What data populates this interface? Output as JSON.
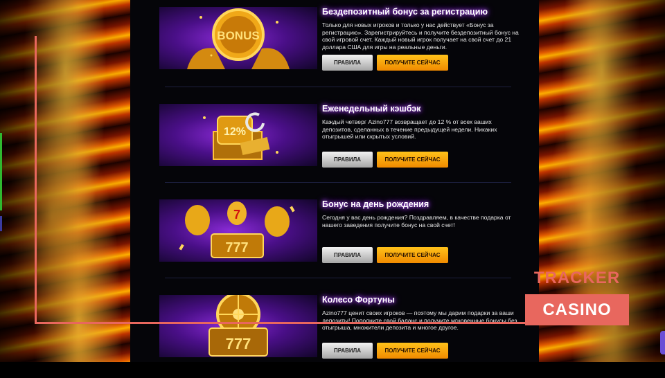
{
  "promotions": [
    {
      "title": "Бездепозитный бонус за регистрацию",
      "description": "Только для новых игроков и только у нас действует «Бонус за регистрацию». Зарегистрируйтесь и получите бездепозитный бонус на свой игровой счет. Каждый новый игрок получает на свой счет до 21 доллара США для игры на реальные деньги.",
      "image_label": "BONUS",
      "rules_label": "ПРАВИЛА",
      "get_label": "ПОЛУЧИТЕ СЕЙЧАС"
    },
    {
      "title": "Еженедельный кэшбэк",
      "description": "Каждый четверг Azino777 возвращает до 12 % от всех ваших депозитов, сделанных в течение предыдущей недели. Никаких отыгрышей или скрытых условий.",
      "image_label": "12%",
      "rules_label": "ПРАВИЛА",
      "get_label": "ПОЛУЧИТЕ СЕЙЧАС"
    },
    {
      "title": "Бонус на день рождения",
      "description": "Сегодня у вас день рождения? Поздравляем, в качестве подарка от нашего заведения получите бонус на свой счет!",
      "image_label": "777",
      "rules_label": "ПРАВИЛА",
      "get_label": "ПОЛУЧИТЕ СЕЙЧАС"
    },
    {
      "title": "Колесо Фортуны",
      "description": "Azino777 ценит своих игроков — поэтому мы дарим подарки за ваши депозиты! Пополните свой баланс и получите мгновенные бонусы без отыгрыша, множители депозита и многое другое.",
      "image_label": "777",
      "rules_label": "ПРАВИЛА",
      "get_label": "ПОЛУЧИТЕ СЕЙЧАС"
    }
  ],
  "watermark": {
    "line1": "TRACKER",
    "line2": "CASINO",
    "color": "#e8675e"
  },
  "colors": {
    "accent": "#f5a300",
    "title_glow": "#b04cff"
  }
}
